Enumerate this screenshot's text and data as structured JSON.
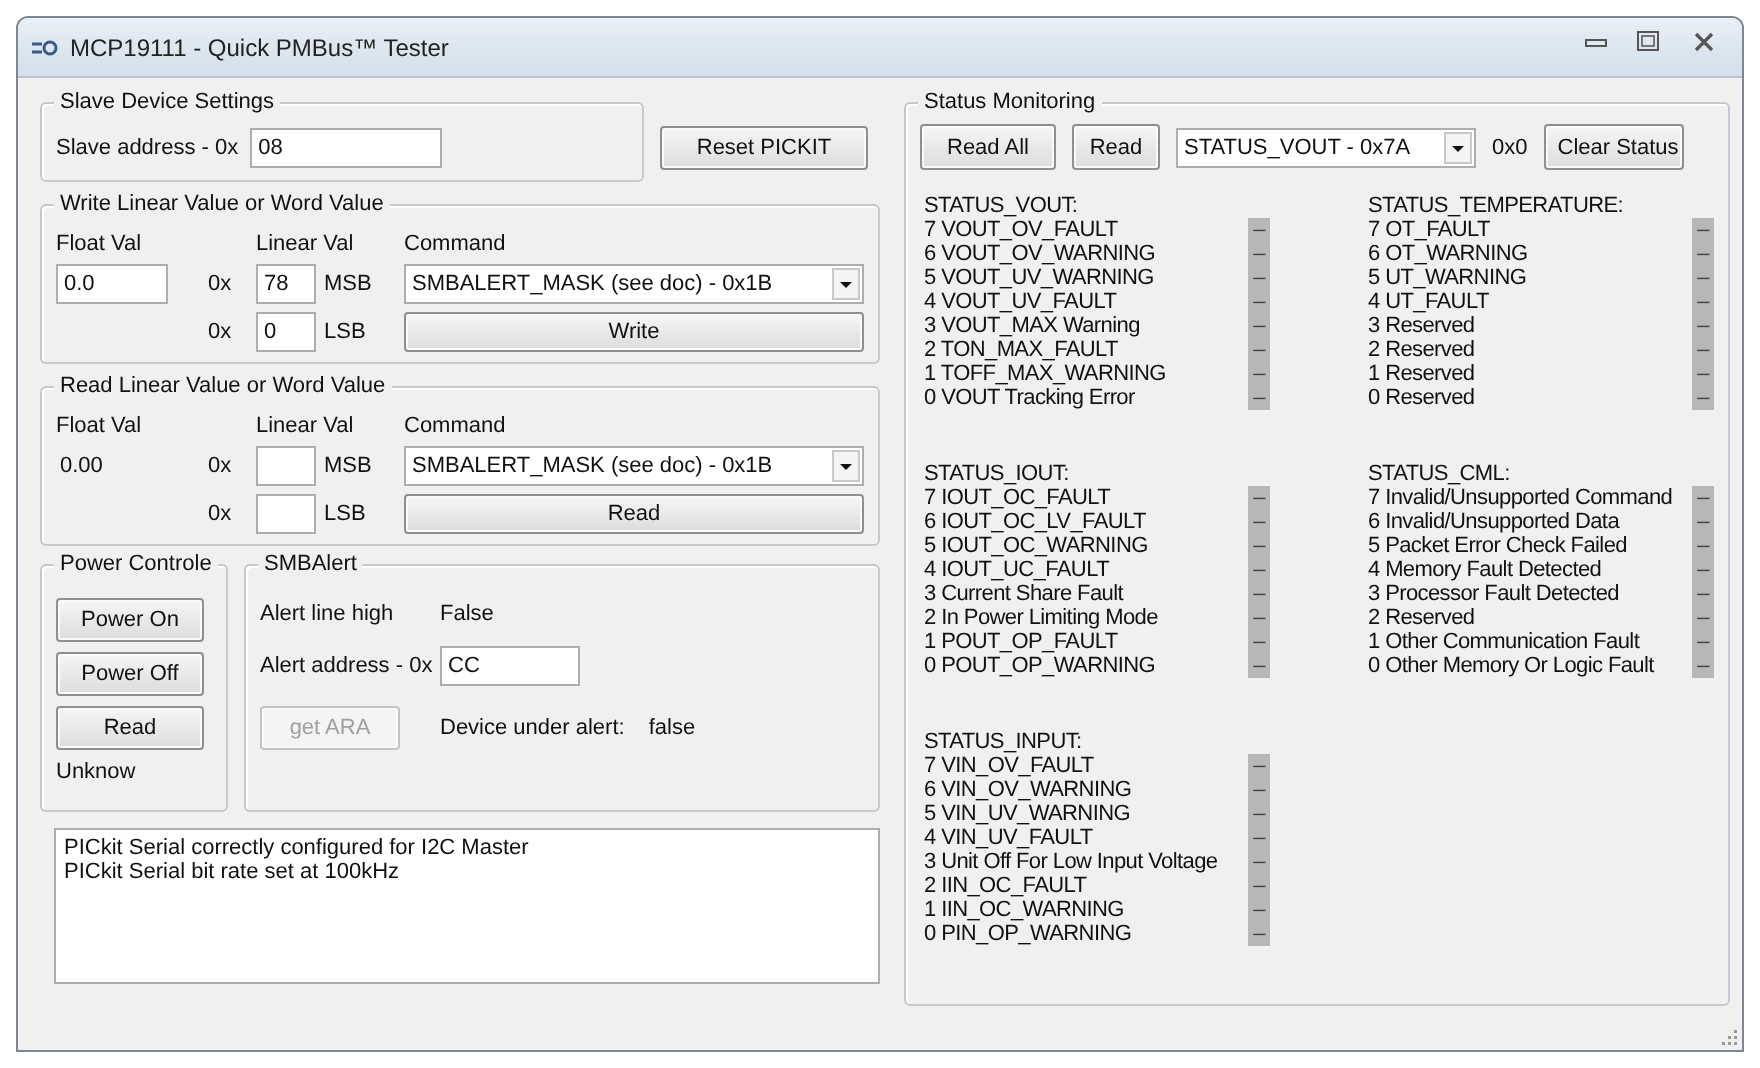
{
  "window": {
    "title": "MCP19111 - Quick PMBus™ Tester"
  },
  "slave_settings": {
    "title": "Slave Device Settings",
    "address_label": "Slave address - 0x",
    "address_value": "08"
  },
  "reset_button": "Reset PICKIT",
  "write_group": {
    "title": "Write Linear Value or Word Value",
    "float_label": "Float Val",
    "linear_label": "Linear Val",
    "command_label": "Command",
    "float_value": "0.0",
    "msb_prefix": "0x",
    "msb_value": "78",
    "msb_label": "MSB",
    "lsb_prefix": "0x",
    "lsb_value": "0",
    "lsb_label": "LSB",
    "command": "SMBALERT_MASK (see doc) - 0x1B",
    "button": "Write"
  },
  "read_group": {
    "title": "Read Linear Value or Word Value",
    "float_label": "Float Val",
    "linear_label": "Linear Val",
    "command_label": "Command",
    "float_value": "0.00",
    "msb_prefix": "0x",
    "msb_label": "MSB",
    "lsb_prefix": "0x",
    "lsb_label": "LSB",
    "command": "SMBALERT_MASK (see doc) - 0x1B",
    "button": "Read"
  },
  "power": {
    "title": "Power Controle",
    "buttons": [
      "Power On",
      "Power Off",
      "Read"
    ],
    "status": "Unknow"
  },
  "smbalert": {
    "title": "SMBAlert",
    "line_label": "Alert line high",
    "line_value": "False",
    "address_label": "Alert address - 0x",
    "address_value": "CC",
    "button": {
      "label": "get ARA",
      "disabled": true
    },
    "device_label": "Device under alert:",
    "device_value": "false"
  },
  "log": [
    "PICkit Serial correctly configured for I2C Master",
    "PICkit Serial bit rate set at 100kHz"
  ],
  "status_monitoring": {
    "title": "Status Monitoring",
    "read_all": "Read All",
    "read": "Read",
    "register": "STATUS_VOUT - 0x7A",
    "register_value": "0x0",
    "clear": "Clear Status",
    "blocks": [
      {
        "title": "STATUS_VOUT:",
        "bits": [
          {
            "label": "7 VOUT_OV_FAULT",
            "value": "–"
          },
          {
            "label": "6 VOUT_OV_WARNING",
            "value": "–"
          },
          {
            "label": "5 VOUT_UV_WARNING",
            "value": "–"
          },
          {
            "label": "4 VOUT_UV_FAULT",
            "value": "–"
          },
          {
            "label": "3 VOUT_MAX Warning",
            "value": "–"
          },
          {
            "label": "2 TON_MAX_FAULT",
            "value": "–"
          },
          {
            "label": "1 TOFF_MAX_WARNING",
            "value": "–"
          },
          {
            "label": "0 VOUT Tracking Error",
            "value": "–"
          }
        ]
      },
      {
        "title": "STATUS_TEMPERATURE:",
        "bits": [
          {
            "label": "7 OT_FAULT",
            "value": "–"
          },
          {
            "label": "6 OT_WARNING",
            "value": "–"
          },
          {
            "label": "5 UT_WARNING",
            "value": "–"
          },
          {
            "label": "4 UT_FAULT",
            "value": "–"
          },
          {
            "label": "3 Reserved",
            "value": "–"
          },
          {
            "label": "2 Reserved",
            "value": "–"
          },
          {
            "label": "1 Reserved",
            "value": "–"
          },
          {
            "label": "0 Reserved",
            "value": "–"
          }
        ]
      },
      {
        "title": "STATUS_IOUT:",
        "bits": [
          {
            "label": "7 IOUT_OC_FAULT",
            "value": "–"
          },
          {
            "label": "6 IOUT_OC_LV_FAULT",
            "value": "–"
          },
          {
            "label": "5 IOUT_OC_WARNING",
            "value": "–"
          },
          {
            "label": "4 IOUT_UC_FAULT",
            "value": "–"
          },
          {
            "label": "3 Current Share Fault",
            "value": "–"
          },
          {
            "label": "2 In Power Limiting Mode",
            "value": "–"
          },
          {
            "label": "1 POUT_OP_FAULT",
            "value": "–"
          },
          {
            "label": "0 POUT_OP_WARNING",
            "value": "–"
          }
        ]
      },
      {
        "title": "STATUS_CML:",
        "bits": [
          {
            "label": "7 Invalid/Unsupported Command",
            "value": "–"
          },
          {
            "label": "6 Invalid/Unsupported Data",
            "value": "–"
          },
          {
            "label": "5 Packet Error Check Failed",
            "value": "–"
          },
          {
            "label": "4 Memory Fault Detected",
            "value": "–"
          },
          {
            "label": "3 Processor Fault Detected",
            "value": "–"
          },
          {
            "label": "2 Reserved",
            "value": "–"
          },
          {
            "label": "1 Other Communication Fault",
            "value": "–"
          },
          {
            "label": "0 Other Memory Or Logic Fault",
            "value": "–"
          }
        ]
      },
      {
        "title": "STATUS_INPUT:",
        "bits": [
          {
            "label": "7 VIN_OV_FAULT",
            "value": "–"
          },
          {
            "label": "6 VIN_OV_WARNING",
            "value": "–"
          },
          {
            "label": "5 VIN_UV_WARNING",
            "value": "–"
          },
          {
            "label": "4 VIN_UV_FAULT",
            "value": "–"
          },
          {
            "label": "3 Unit Off For Low Input Voltage",
            "value": "–"
          },
          {
            "label": "2 IIN_OC_FAULT",
            "value": "–"
          },
          {
            "label": "1 IIN_OC_WARNING",
            "value": "–"
          },
          {
            "label": "0 PIN_OP_WARNING",
            "value": "–"
          }
        ]
      }
    ]
  }
}
